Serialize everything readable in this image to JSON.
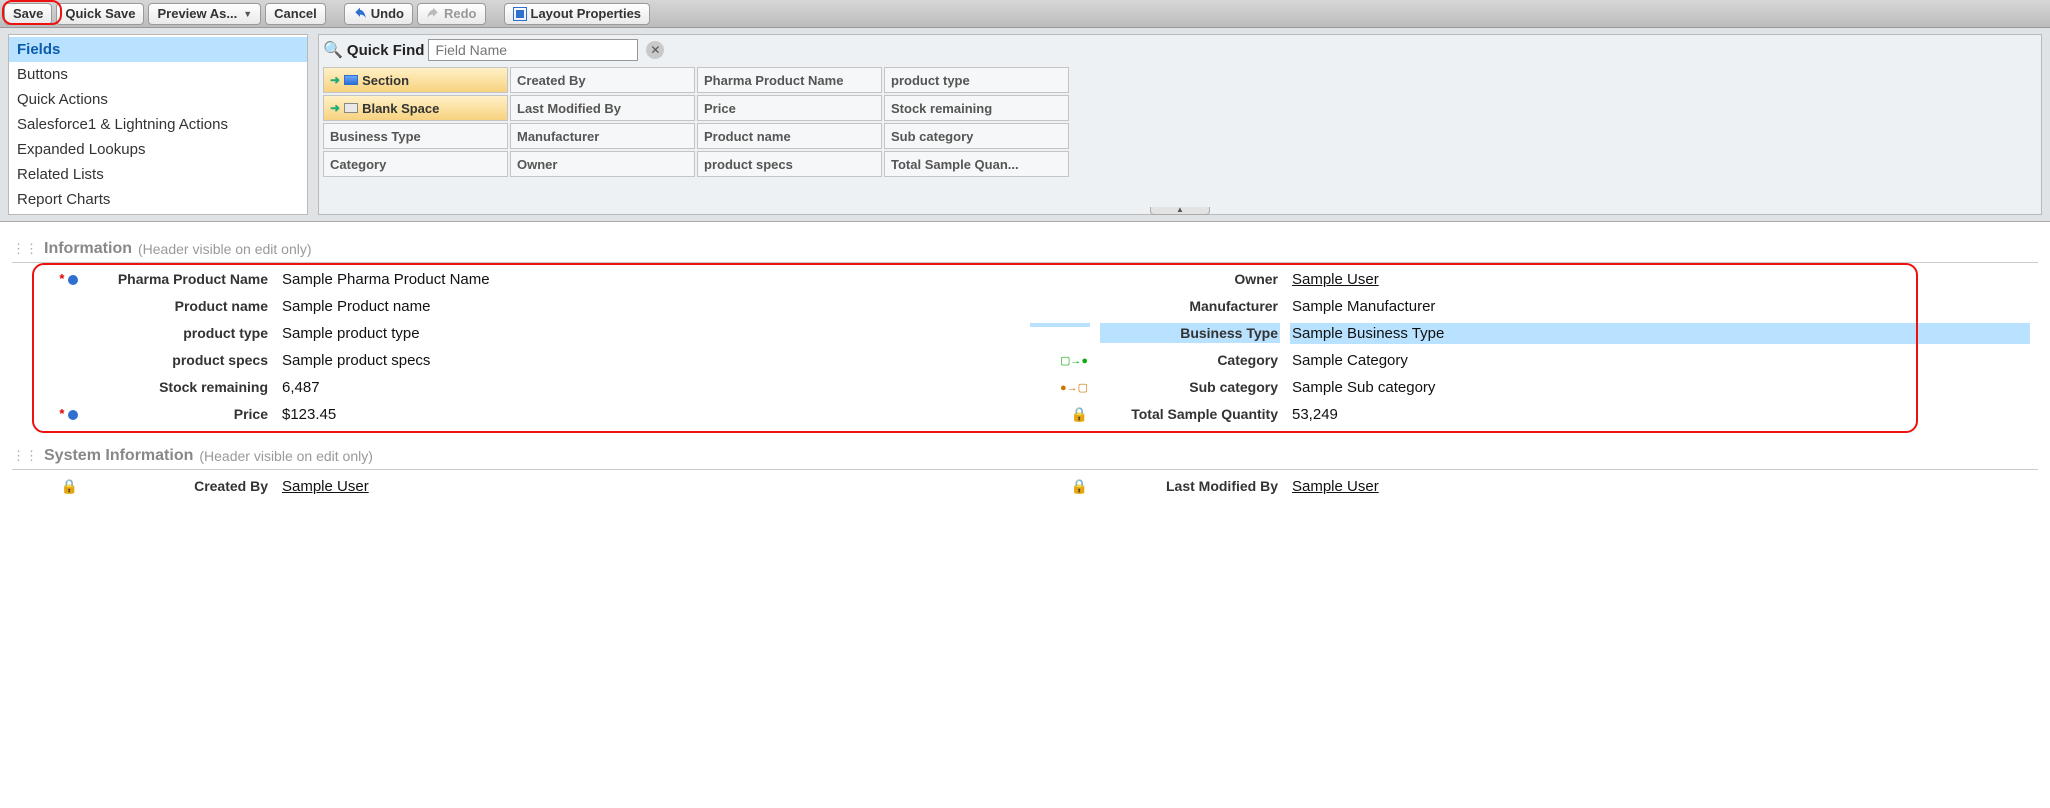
{
  "toolbar": {
    "save": "Save",
    "quick_save": "Quick Save",
    "preview_as": "Preview As...",
    "cancel": "Cancel",
    "undo": "Undo",
    "redo": "Redo",
    "layout_properties": "Layout Properties"
  },
  "sidebar": {
    "items": [
      "Fields",
      "Buttons",
      "Quick Actions",
      "Salesforce1 & Lightning Actions",
      "Expanded Lookups",
      "Related Lists",
      "Report Charts"
    ],
    "selected_index": 0
  },
  "quick_find": {
    "label": "Quick Find",
    "placeholder": "Field Name"
  },
  "palette_fields": {
    "col1": [
      "Section",
      "Blank Space",
      "Business Type",
      "Category"
    ],
    "col2": [
      "Created By",
      "Last Modified By",
      "Manufacturer",
      "Owner"
    ],
    "col3": [
      "Pharma Product Name",
      "Price",
      "Product name",
      "product specs"
    ],
    "col4": [
      "product type",
      "Stock remaining",
      "Sub category",
      "Total Sample Quan..."
    ]
  },
  "sections": {
    "information": {
      "title": "Information",
      "note": "(Header visible on edit only)",
      "left": [
        {
          "label": "Pharma Product Name",
          "value": "Sample Pharma Product Name",
          "required": true,
          "std": true
        },
        {
          "label": "Product name",
          "value": "Sample Product name"
        },
        {
          "label": "product type",
          "value": "Sample product type"
        },
        {
          "label": "product specs",
          "value": "Sample product specs"
        },
        {
          "label": "Stock remaining",
          "value": "6,487"
        },
        {
          "label": "Price",
          "value": "$123.45",
          "required": true,
          "std": true
        }
      ],
      "right": [
        {
          "label": "Owner",
          "value": "Sample User",
          "link": true
        },
        {
          "label": "Manufacturer",
          "value": "Sample Manufacturer"
        },
        {
          "label": "Business Type",
          "value": "Sample Business Type",
          "highlight": true
        },
        {
          "label": "Category",
          "value": "Sample Category",
          "dep": "controlling"
        },
        {
          "label": "Sub category",
          "value": "Sample Sub category",
          "dep": "dependent"
        },
        {
          "label": "Total Sample Quantity",
          "value": "53,249",
          "locked": true
        }
      ]
    },
    "system": {
      "title": "System Information",
      "note": "(Header visible on edit only)",
      "left": {
        "label": "Created By",
        "value": "Sample User",
        "locked": true,
        "link": true
      },
      "right": {
        "label": "Last Modified By",
        "value": "Sample User",
        "locked": true,
        "link": true
      }
    }
  }
}
